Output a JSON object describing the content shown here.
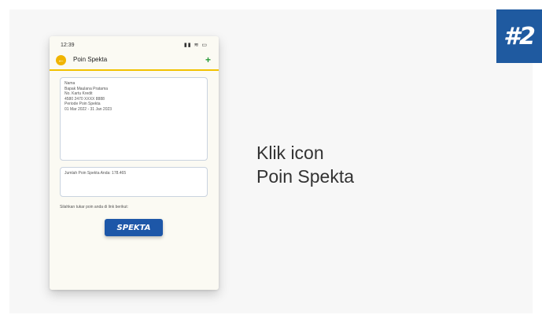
{
  "step": {
    "label": "#2"
  },
  "phone": {
    "status_time": "12:39",
    "status_icons": "▮▮ ≋ ▭",
    "header_title": "Poin Spekta",
    "info_lines": [
      "Nama",
      "Bapak Maulana Pratama",
      "No. Kartu Kredit",
      "4580 2470 XXXX 8888",
      "Periode Poin Spekta",
      "01 Mar 2022 - 31 Jan 2023"
    ],
    "points_text": "Jumlah Poin Spekta Anda: 178.465",
    "redeem_text": "Silahkan tukar poin anda di link berikut:",
    "logo_text": "SPEKTA"
  },
  "instruction": {
    "line1": "Klik icon",
    "line2": "Poin Spekta"
  },
  "colors": {
    "accent": "#1f5aa0",
    "header_underline": "#f2c200"
  },
  "icons": [
    "back-arrow-icon",
    "plus-icon",
    "signal-icon",
    "wifi-icon",
    "battery-icon"
  ]
}
